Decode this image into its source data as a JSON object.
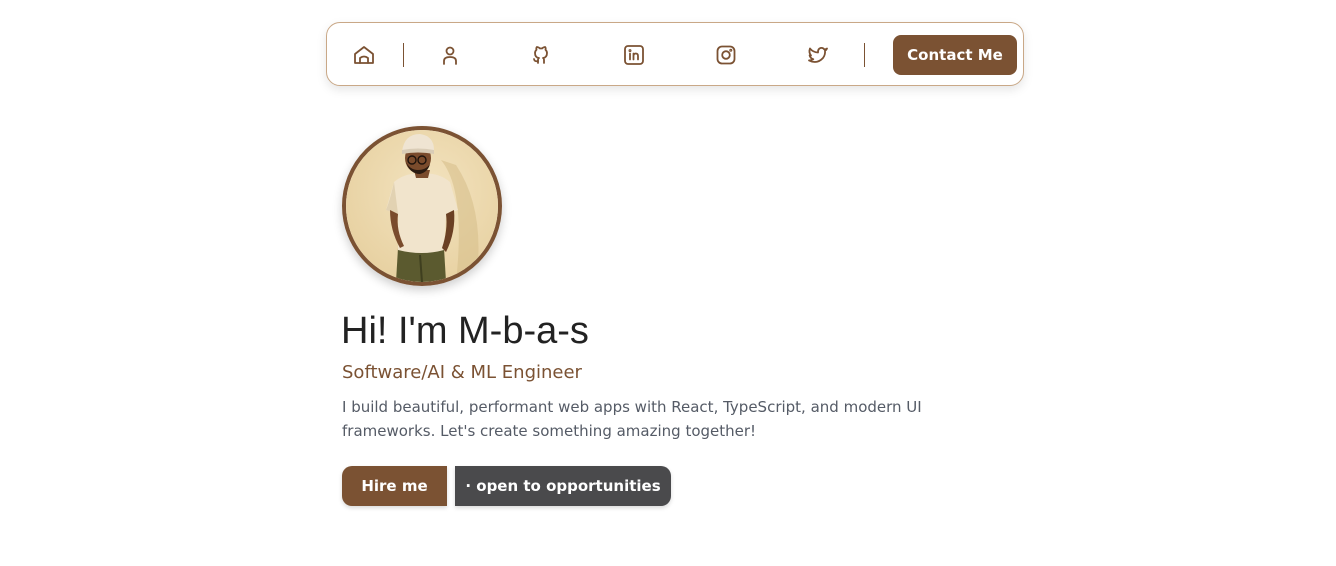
{
  "nav": {
    "icons": [
      "home-icon",
      "user-icon",
      "github-icon",
      "linkedin-icon",
      "instagram-icon",
      "twitter-icon"
    ],
    "contact_label": "Contact Me"
  },
  "hero": {
    "title": "Hi! I'm M-b-a-s",
    "role": "Software/AI & ML Engineer",
    "description": "I build beautiful, performant web apps with React, TypeScript, and modern UI frameworks. Let's create something amazing together!",
    "hire_label": "Hire me",
    "open_label": "· open to opportunities"
  },
  "colors": {
    "accent": "#7b5233",
    "secondary_button": "#4a4a4c",
    "text_dark": "#222222",
    "text_muted": "#555b66"
  }
}
